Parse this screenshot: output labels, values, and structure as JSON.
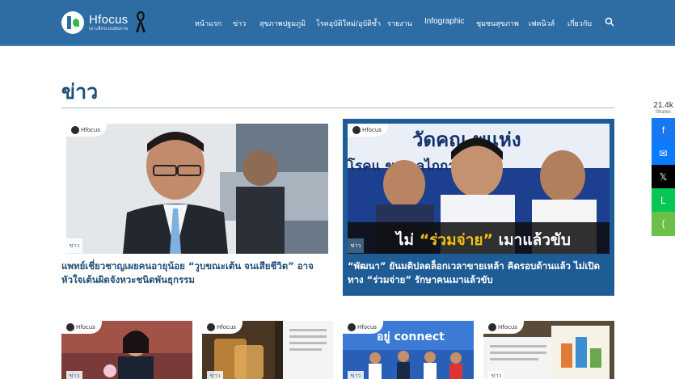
{
  "header": {
    "brand_name": "Hfocus",
    "brand_tagline": "เจาะลึกระบบสุขภาพ",
    "nav": [
      "หน้าแรก",
      "ข่าว",
      "สุขภาพปฐมภูมิ",
      "โรคอุบัติใหม่/อุบัติซ้ำ",
      "รายงาน",
      "Infographic",
      "ชุมชนสุขภาพ",
      "เฟคนิวส์",
      "เกี่ยวกับ"
    ]
  },
  "page_title": "ข่าว",
  "featured": [
    {
      "badge": "Hfocus",
      "tag": "ข่าว",
      "title": "แพทย์เชี่ยวชาญเผยคนอายุน้อย “วูบขณะเต้น จนเสียชีวิต” อาจหัวใจเต้นผิดจังหวะชนิดพันธุกรรม"
    },
    {
      "badge": "Hfocus",
      "tag": "ข่าว",
      "image_text_top": "วัดคณ  พแห่ง",
      "image_text_mid": "โรคแ   ขุภา   ลไกการ",
      "image_caption_pre": "ไม่ ",
      "image_caption_quote": "“ร่วมจ่าย”",
      "image_caption_post": " เมาแล้วขับ",
      "title": "“พัฒนา” ยันมติปลดล็อกเวลาขายเหล้า คิดรอบด้านแล้ว ไม่เปิดทาง “ร่วมจ่าย” รักษาคนเมาแล้วขับ"
    }
  ],
  "thumbnails": [
    {
      "badge": "Hfocus",
      "tag": "ข่าว"
    },
    {
      "badge": "Hfocus",
      "tag": "ข่าว"
    },
    {
      "badge": "Hfocus",
      "tag": "ข่าว",
      "image_text": "อยู่ connect"
    },
    {
      "badge": "Hfocus",
      "tag": "ข่าว"
    }
  ],
  "share": {
    "count": "21.4k",
    "label": "Shares",
    "buttons": [
      {
        "name": "facebook",
        "glyph": "f",
        "color": "#1877f2"
      },
      {
        "name": "messenger",
        "glyph": "✉",
        "color": "#0a7cff"
      },
      {
        "name": "x",
        "glyph": "𝕏",
        "color": "#000000"
      },
      {
        "name": "line",
        "glyph": "L",
        "color": "#06c755"
      },
      {
        "name": "share",
        "glyph": "⟨",
        "color": "#6cc04a"
      }
    ]
  }
}
